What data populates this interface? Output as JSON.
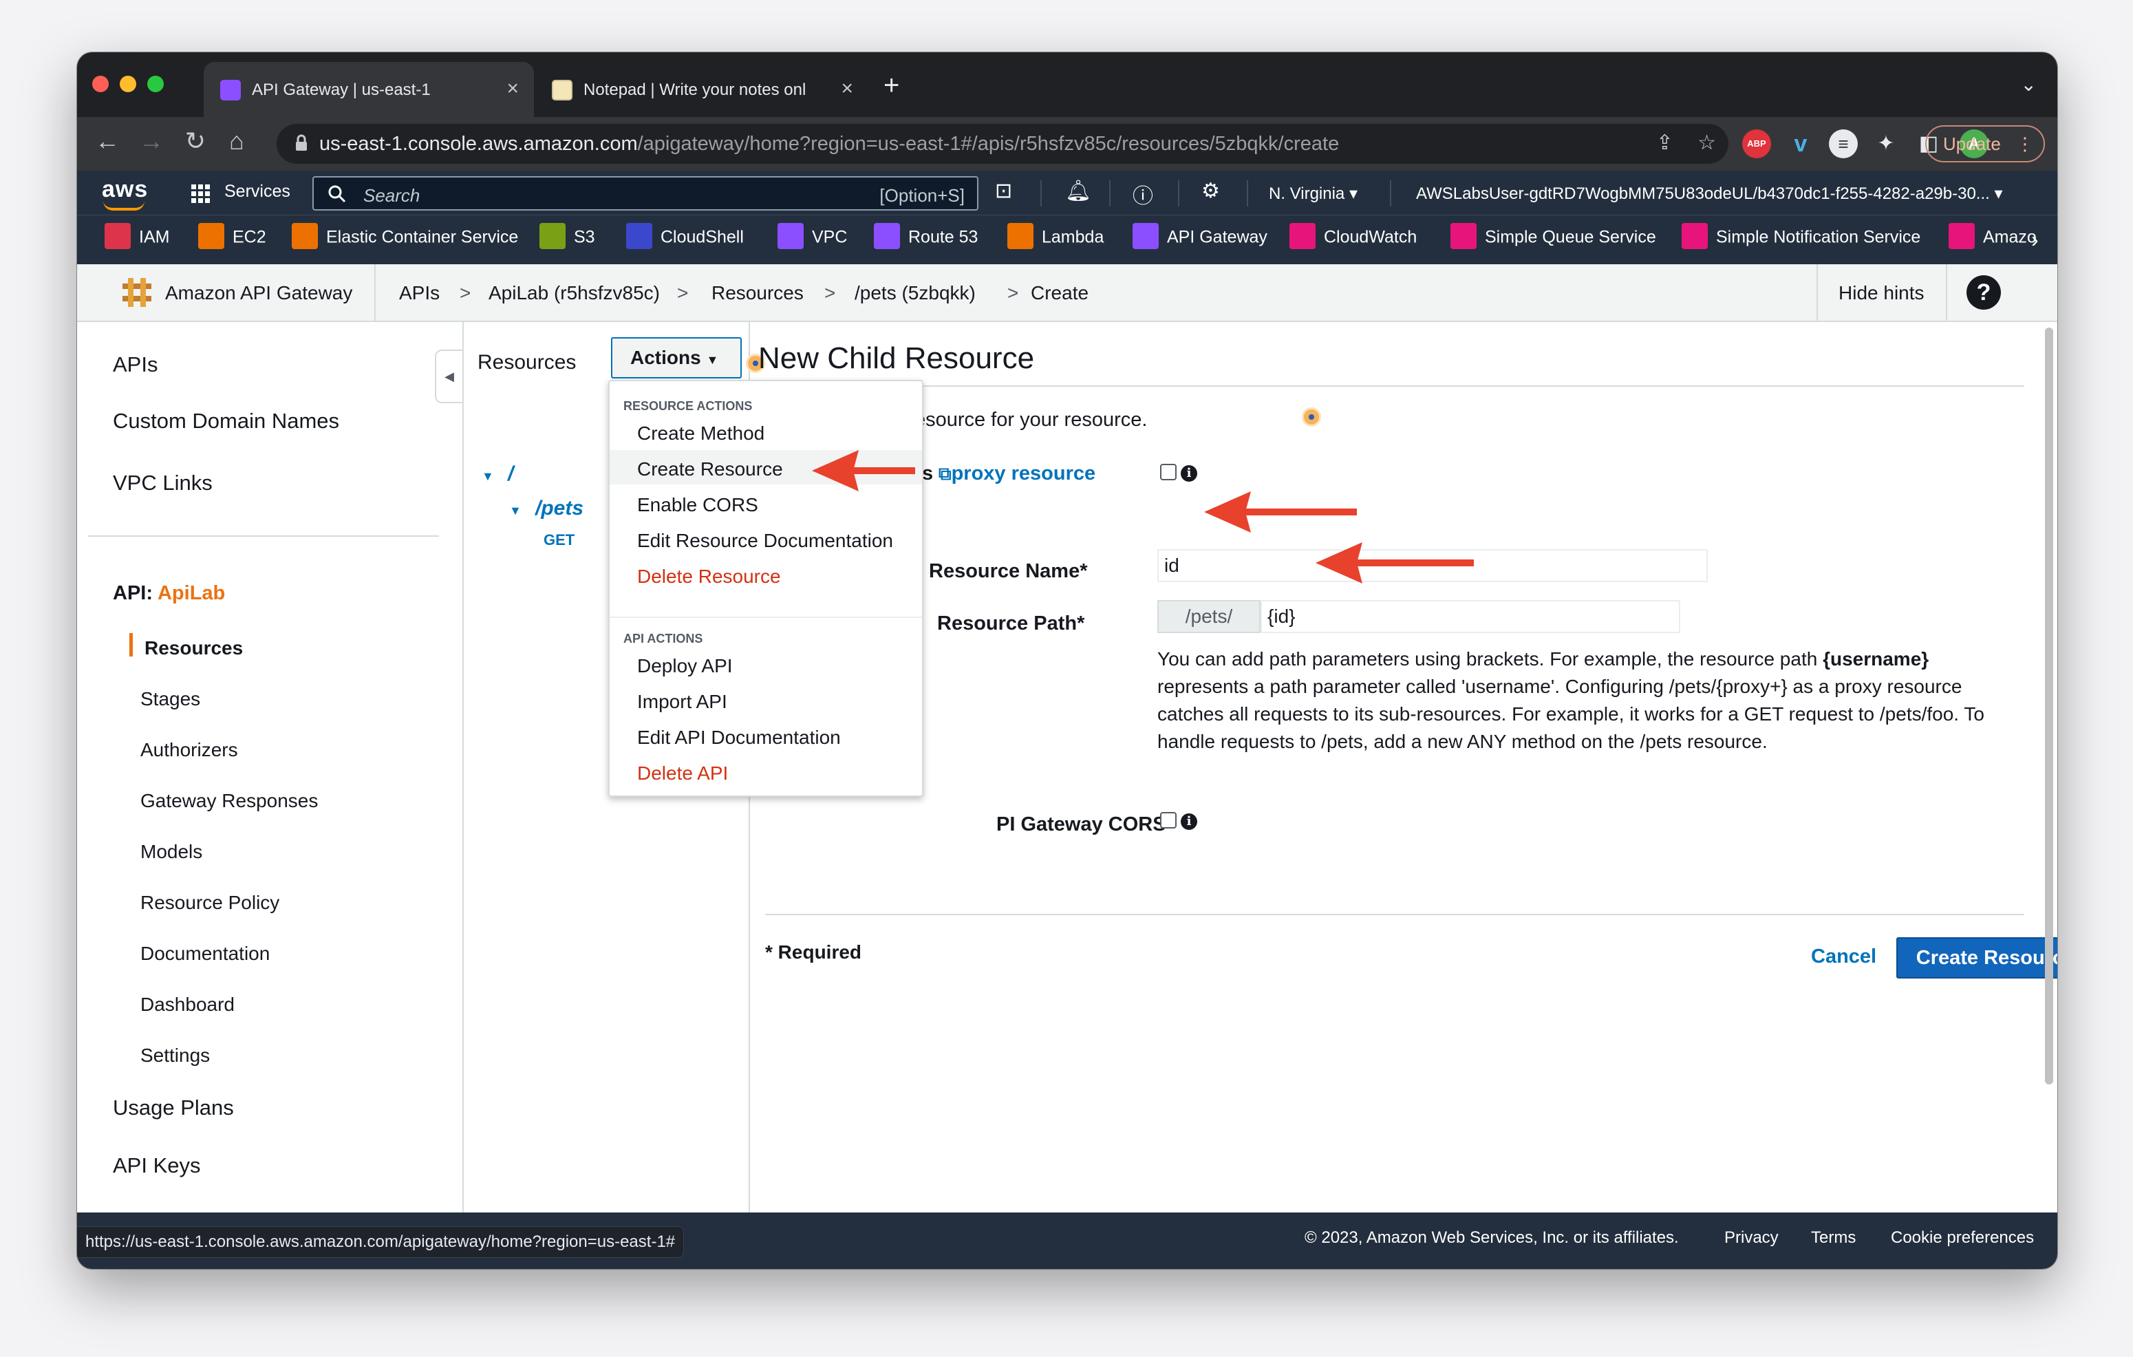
{
  "browser": {
    "tabs": [
      {
        "title": "API Gateway | us-east-1",
        "favicon": "api-gateway-icon"
      },
      {
        "title": "Notepad | Write your notes onl",
        "favicon": "notepad-icon"
      }
    ],
    "url_host": "us-east-1.console.aws.amazon.com",
    "url_path": "/apigateway/home?region=us-east-1#/apis/r5hsfzv85c/resources/5zbqkk/create",
    "update_label": "Update",
    "profile_initial": "A",
    "abp_label": "ABP",
    "status_url": "https://us-east-1.console.aws.amazon.com/apigateway/home?region=us-east-1#"
  },
  "aws_nav": {
    "logo": "aws",
    "services": "Services",
    "search_placeholder": "Search",
    "search_shortcut": "[Option+S]",
    "region": "N. Virginia",
    "account": "AWSLabsUser-gdtRD7WogbMM75U83odeUL/b4370dc1-f255-4282-a29b-30..."
  },
  "favorites": [
    {
      "label": "IAM",
      "color": "#dd344c"
    },
    {
      "label": "EC2",
      "color": "#ed7100"
    },
    {
      "label": "Elastic Container Service",
      "color": "#ed7100"
    },
    {
      "label": "S3",
      "color": "#7aa116"
    },
    {
      "label": "CloudShell",
      "color": "#3b48cc"
    },
    {
      "label": "VPC",
      "color": "#8c4fff"
    },
    {
      "label": "Route 53",
      "color": "#8c4fff"
    },
    {
      "label": "Lambda",
      "color": "#ed7100"
    },
    {
      "label": "API Gateway",
      "color": "#8c4fff"
    },
    {
      "label": "CloudWatch",
      "color": "#e7157b"
    },
    {
      "label": "Simple Queue Service",
      "color": "#e7157b"
    },
    {
      "label": "Simple Notification Service",
      "color": "#e7157b"
    },
    {
      "label": "Amazo",
      "color": "#e7157b"
    }
  ],
  "breadcrumb": {
    "service": "Amazon API Gateway",
    "items": [
      "APIs",
      "ApiLab (r5hsfzv85c)",
      "Resources",
      "/pets (5zbqkk)",
      "Create"
    ],
    "separator": ">",
    "hide_hints": "Hide hints",
    "help": "?"
  },
  "sidebar": {
    "top_items": [
      "APIs",
      "Custom Domain Names",
      "VPC Links"
    ],
    "api_prefix": "API:",
    "api_name": "ApiLab",
    "sub_items": [
      "Resources",
      "Stages",
      "Authorizers",
      "Gateway Responses",
      "Models",
      "Resource Policy",
      "Documentation",
      "Dashboard",
      "Settings"
    ],
    "bottom_items": [
      "Usage Plans",
      "API Keys"
    ]
  },
  "resources_pane": {
    "title": "Resources",
    "actions_label": "Actions",
    "tree": [
      {
        "path": "/"
      },
      {
        "path": "/pets",
        "methods": [
          "GET"
        ]
      }
    ]
  },
  "actions_menu": {
    "resource_heading": "RESOURCE ACTIONS",
    "resource_items": [
      "Create Method",
      "Create Resource",
      "Enable CORS",
      "Edit Resource Documentation",
      "Delete Resource"
    ],
    "api_heading": "API ACTIONS",
    "api_items": [
      "Deploy API",
      "Import API",
      "Edit API Documentation",
      "Delete API"
    ]
  },
  "form": {
    "title": "New Child Resource",
    "subtitle_visible": "reate a new child resource for your resource.",
    "proxy_label_fragment": "s",
    "proxy_link": "proxy resource",
    "resource_name_label": "Resource Name*",
    "resource_name_value": "id",
    "resource_path_label": "Resource Path*",
    "resource_path_prefix": "/pets/",
    "resource_path_value": "{id}",
    "help_1": "You can add path parameters using brackets. For example, the resource path ",
    "help_bold": "{username}",
    "help_2": " represents a path parameter called 'username'. Configuring /pets/{proxy+} as a proxy resource catches all requests to its sub-resources. For example, it works for a GET request to /pets/foo. To handle requests to /pets, add a new ANY method on the /pets resource.",
    "cors_label": "PI Gateway CORS",
    "required_note": "* Required",
    "cancel": "Cancel",
    "submit": "Create Resource"
  },
  "footer": {
    "copyright": "© 2023, Amazon Web Services, Inc. or its affiliates.",
    "links": [
      "Privacy",
      "Terms",
      "Cookie preferences"
    ]
  },
  "colors": {
    "aws_nav": "#232f3e",
    "link": "#0073bb",
    "danger": "#d13212",
    "primary_button": "#1166bb",
    "annotation_arrow": "#e8412c",
    "api_name": "#ec7211"
  }
}
